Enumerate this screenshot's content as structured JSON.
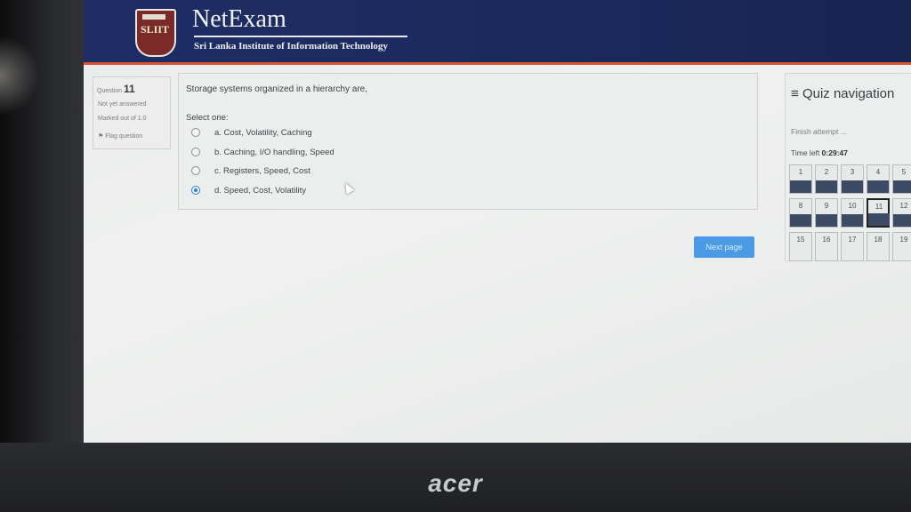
{
  "header": {
    "brand_title": "NetExam",
    "brand_subtitle": "Sri Lanka Institute of Information Technology",
    "logo_text": "SLIIT"
  },
  "question_info": {
    "label": "Question",
    "number": "11",
    "status": "Not yet answered",
    "marks": "Marked out of 1.0",
    "flag": "Flag question"
  },
  "question": {
    "text": "Storage systems organized in a hierarchy are,",
    "select_label": "Select one:",
    "options": [
      {
        "label": "a. Cost, Volatility, Caching",
        "selected": false
      },
      {
        "label": "b. Caching, I/O handling, Speed",
        "selected": false
      },
      {
        "label": "c. Registers, Speed, Cost",
        "selected": false
      },
      {
        "label": "d. Speed, Cost, Volatility",
        "selected": true
      }
    ]
  },
  "next_button": "Next page",
  "quiz_nav": {
    "title": "Quiz navigation",
    "finish": "Finish attempt ...",
    "time_label": "Time left",
    "time_value": "0:29:47",
    "questions": [
      "1",
      "2",
      "3",
      "4",
      "5",
      "8",
      "9",
      "10",
      "11",
      "12",
      "15",
      "16",
      "17",
      "18",
      "19"
    ],
    "current": "11"
  },
  "laptop_brand": "acer"
}
